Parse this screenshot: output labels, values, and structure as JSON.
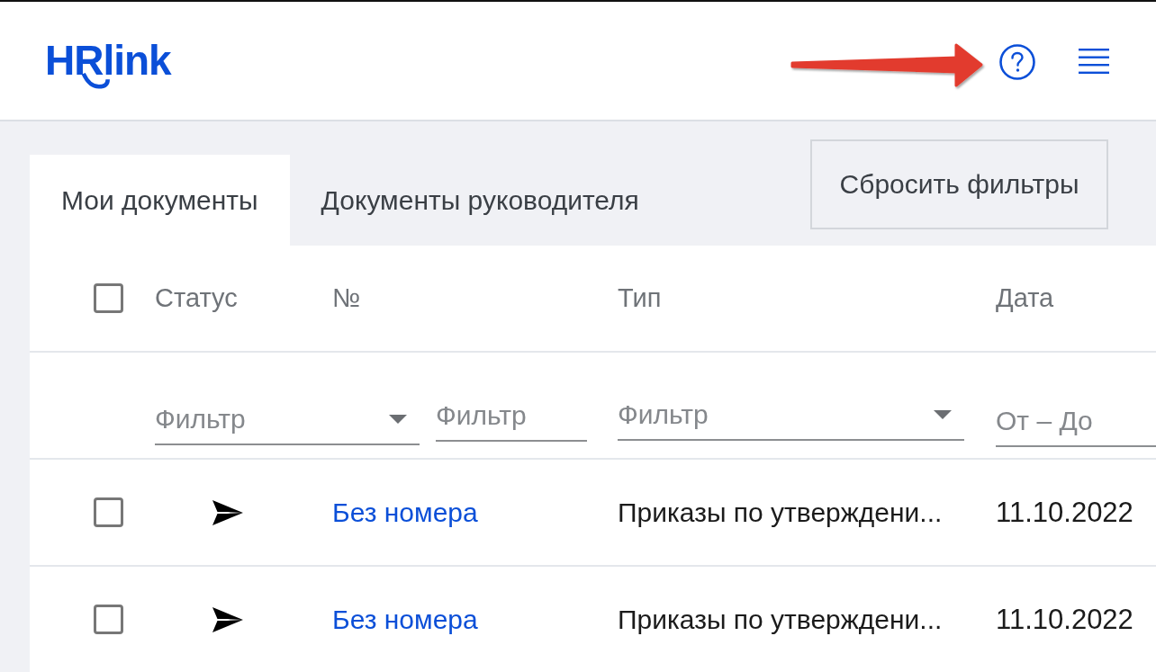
{
  "header": {
    "logo": "HRlink"
  },
  "tabs": [
    {
      "label": "Мои документы",
      "selected": true
    },
    {
      "label": "Документы руководителя",
      "selected": false
    }
  ],
  "reset_button": "Сбросить фильтры",
  "table": {
    "select_all": {
      "checked": false
    },
    "columns": [
      "Статус",
      "№",
      "Тип",
      "Дата"
    ],
    "filters": [
      {
        "kind": "select",
        "placeholder": "Фильтр"
      },
      {
        "kind": "text",
        "placeholder": "Фильтр"
      },
      {
        "kind": "select",
        "placeholder": "Фильтр"
      },
      {
        "kind": "text",
        "placeholder": "От – До"
      }
    ],
    "rows": [
      {
        "checked": false,
        "number": "Без номера",
        "type": "Приказы по утверждени...",
        "date": "11.10.2022"
      },
      {
        "checked": false,
        "number": "Без номера",
        "type": "Приказы по утверждени...",
        "date": "11.10.2022"
      }
    ]
  }
}
